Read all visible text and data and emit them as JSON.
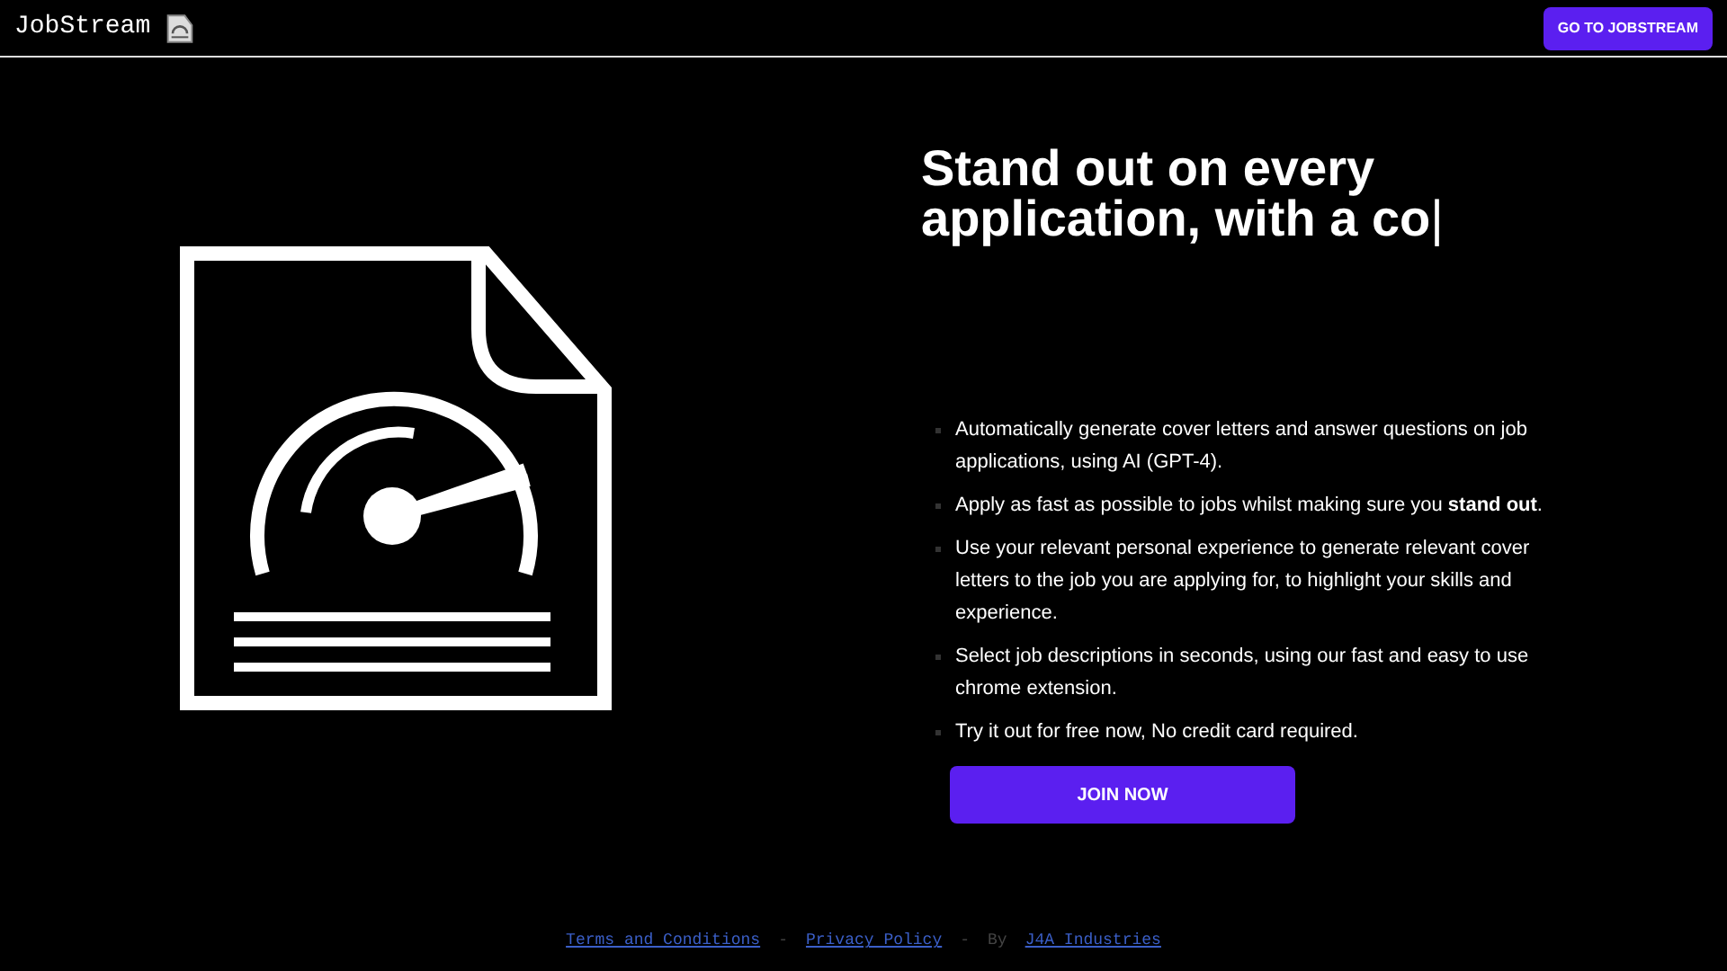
{
  "navbar": {
    "brand": "JobStream",
    "cta": "GO TO JOBSTREAM"
  },
  "hero": {
    "headline": "Stand out on every application, with a co",
    "cursor": "|",
    "features": [
      "Automatically generate cover letters and answer questions on job applications, using AI (GPT-4).",
      "Apply as fast as possible to jobs whilst making sure you **stand out**.",
      "Use your relevant personal experience to generate relevant cover letters to the job you are applying for, to highlight your skills and experience.",
      "Select job descriptions in seconds, using our fast and easy to use chrome extension.",
      "Try it out for free now, No credit card required."
    ],
    "button": "JOIN NOW"
  },
  "footer": [
    {
      "kind": "link",
      "text": "Terms and Conditions"
    },
    {
      "kind": "sep",
      "text": "-"
    },
    {
      "kind": "link",
      "text": "Privacy Policy"
    },
    {
      "kind": "sep",
      "text": "-"
    },
    {
      "kind": "sep",
      "text": "By"
    },
    {
      "kind": "link",
      "text": "J4A Industries"
    }
  ]
}
